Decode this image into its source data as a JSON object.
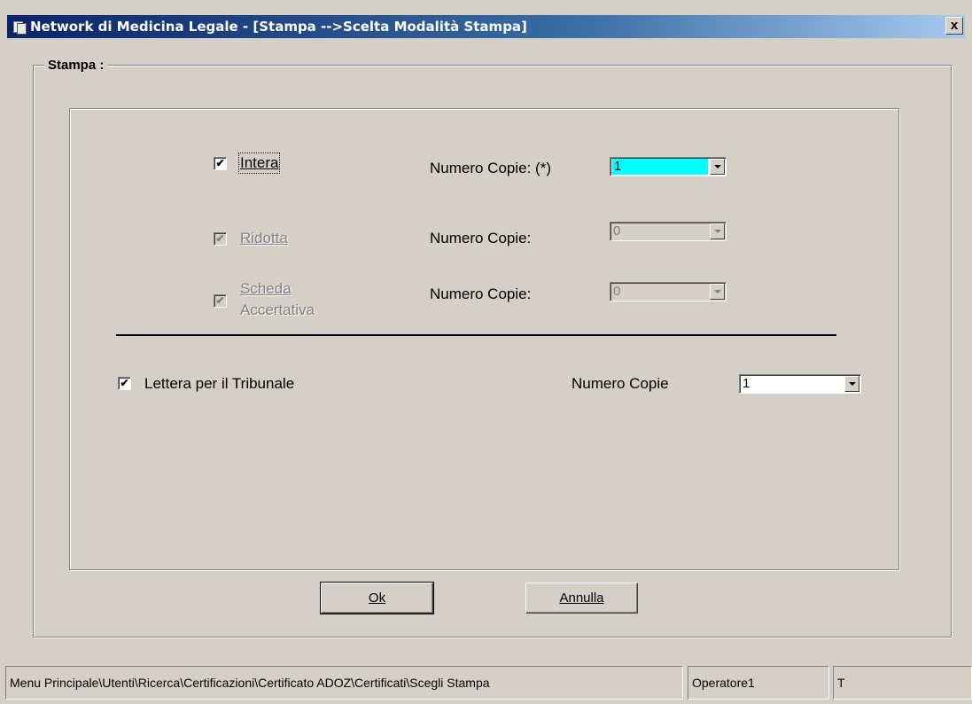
{
  "window": {
    "title": "Network di Medicina Legale - [Stampa -->Scelta Modalità Stampa]",
    "close_label": "x"
  },
  "group": {
    "legend": "Stampa :"
  },
  "options": [
    {
      "label": "Intera",
      "checked": true,
      "enabled": true,
      "copies_label": "Numero Copie: (*)",
      "copies_value": "1"
    },
    {
      "label": "Ridotta",
      "checked": true,
      "enabled": false,
      "copies_label": "Numero Copie:",
      "copies_value": "0"
    },
    {
      "label_line1": "Scheda",
      "label_line2": "Accertativa",
      "checked": true,
      "enabled": false,
      "copies_label": "Numero Copie:",
      "copies_value": "0"
    }
  ],
  "letter": {
    "label": "Lettera per il Tribunale",
    "checked": true,
    "copies_label": "Numero Copie",
    "copies_value": "1"
  },
  "buttons": {
    "ok_label": "Ok",
    "cancel_label": "Annulla"
  },
  "statusbar": {
    "path": "Menu Principale\\Utenti\\Ricerca\\Certificazioni\\Certificato ADOZ\\Certificati\\Scegli Stampa",
    "user": "Operatore1",
    "extra": "T"
  },
  "check_mark": "✔"
}
